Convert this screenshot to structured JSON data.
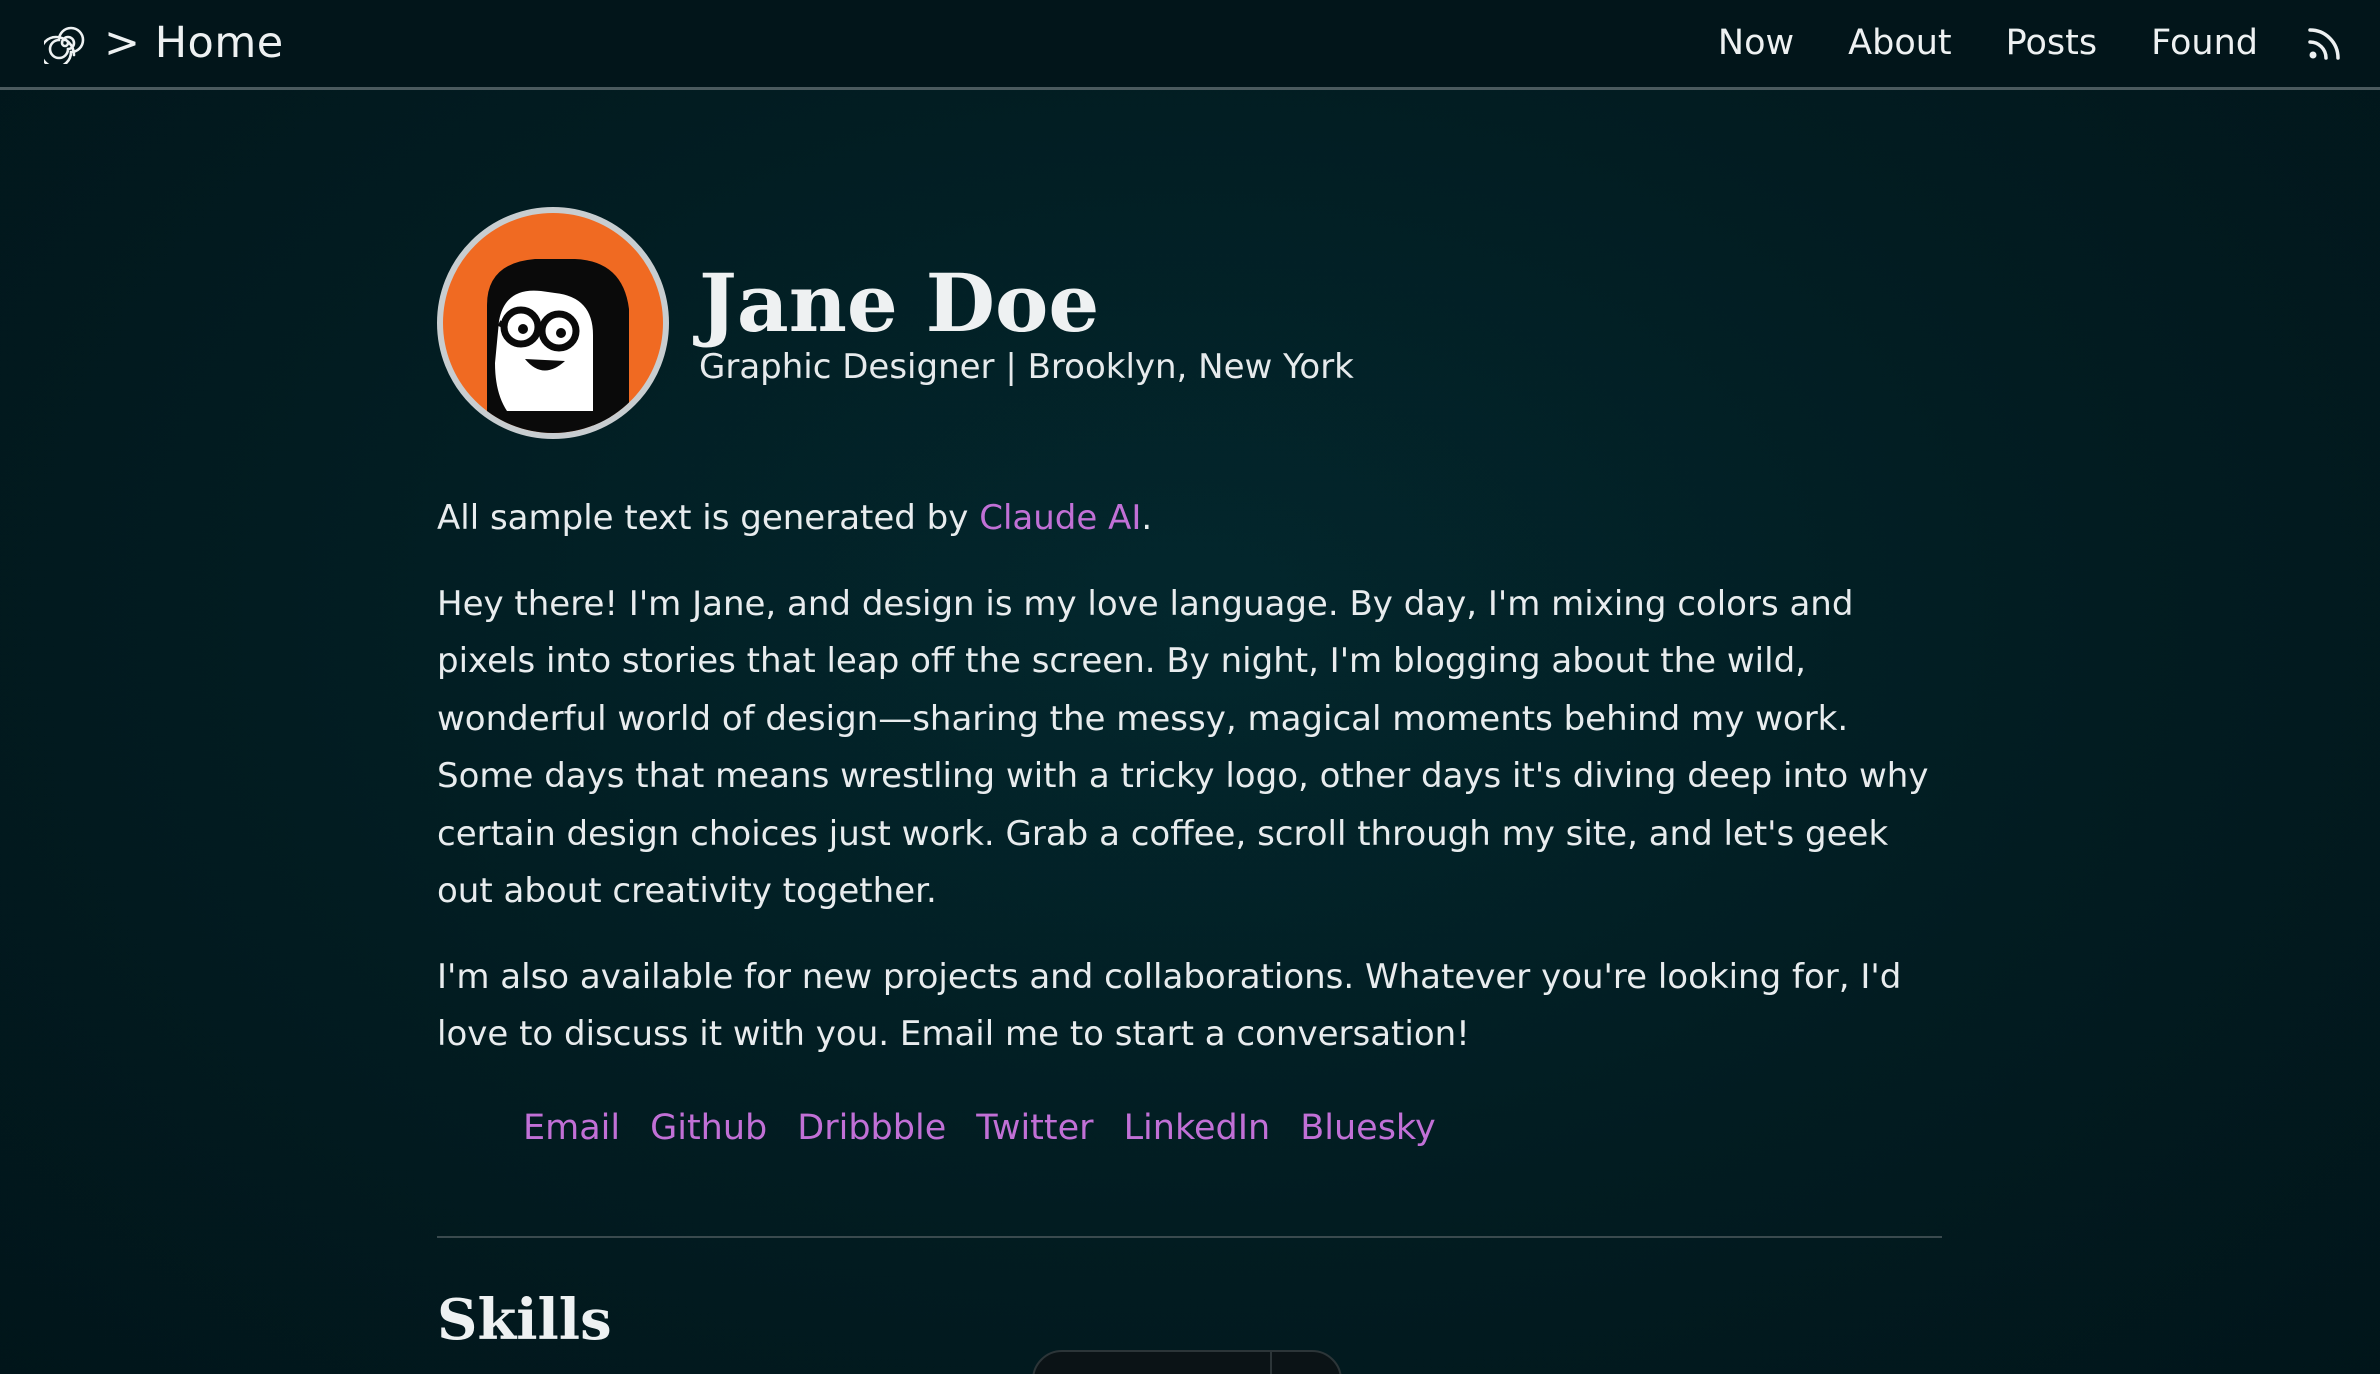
{
  "header": {
    "brand_icon": "spiral-icon",
    "brand_label": "> Home",
    "nav": [
      {
        "label": "Now"
      },
      {
        "label": "About"
      },
      {
        "label": "Posts"
      },
      {
        "label": "Found"
      }
    ],
    "rss_icon": "rss-icon"
  },
  "profile": {
    "name": "Jane Doe",
    "tagline": "Graphic Designer | Brooklyn, New York",
    "avatar_icon": "cartoon-avatar-icon"
  },
  "intro": {
    "prefix": "All sample text is generated by ",
    "link": "Claude AI",
    "suffix": "."
  },
  "bio": "Hey there! I'm Jane, and design is my love language. By day, I'm mixing colors and pixels into stories that leap off the screen. By night, I'm blogging about the wild, wonderful world of design—sharing the messy, magical moments behind my work. Some days that means wrestling with a tricky logo, other days it's diving deep into why certain design choices just work. Grab a coffee, scroll through my site, and let's geek out about creativity together.",
  "availability": "I'm also available for new projects and collaborations. Whatever you're looking for, I'd love to discuss it with you. Email me to start a conversation!",
  "social": [
    {
      "label": "Email"
    },
    {
      "label": "Github"
    },
    {
      "label": "Dribbble"
    },
    {
      "label": "Twitter"
    },
    {
      "label": "LinkedIn"
    },
    {
      "label": "Bluesky"
    }
  ],
  "sections": {
    "skills_title": "Skills"
  },
  "colors": {
    "background": "#021c21",
    "header_background": "#02151a",
    "link": "#c170d6",
    "avatar_orange": "#f06a22",
    "text": "#e8ecee"
  }
}
